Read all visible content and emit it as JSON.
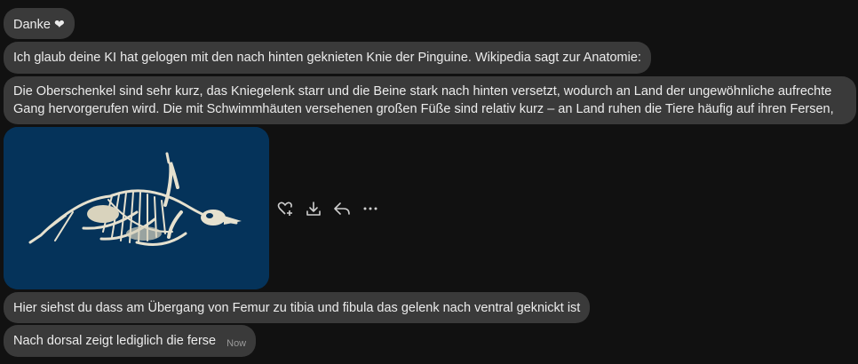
{
  "messages": [
    {
      "text": "Danke",
      "emoji": "❤"
    },
    {
      "text": "Ich glaub deine KI hat gelogen mit den nach hinten geknieten Knie der Pinguine. Wikipedia sagt zur Anatomie:"
    },
    {
      "text": "Die Oberschenkel sind sehr kurz, das Kniegelenk starr und die Beine stark nach hinten versetzt, wodurch an Land der ungewöhnliche aufrechte Gang hervorgerufen wird. Die mit Schwimmhäuten versehenen großen Füße sind relativ kurz – an Land ruhen die Tiere häufig auf ihren Fersen,"
    },
    {
      "attachment": {
        "type": "image",
        "subject": "penguin-skeleton"
      }
    },
    {
      "text": "Hier siehst du dass am Übergang von Femur zu tibia und fibula das gelenk nach ventral geknickt ist"
    },
    {
      "text": "Nach dorsal zeigt lediglich die ferse",
      "time": "Now"
    }
  ],
  "image_actions": [
    {
      "icon": "heart-plus-icon"
    },
    {
      "icon": "download-icon"
    },
    {
      "icon": "reply-icon"
    },
    {
      "icon": "more-icon"
    }
  ],
  "colors": {
    "background": "#111111",
    "bubble": "#3a3a3a",
    "text": "#ececec",
    "image_background": "#05335a"
  }
}
